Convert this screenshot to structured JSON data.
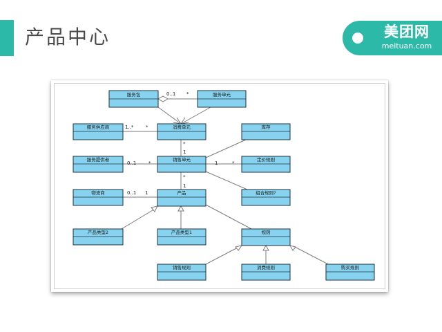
{
  "slide": {
    "title": "产品中心"
  },
  "logo": {
    "text": "美团网",
    "sub": "meituan.com",
    "color": "#2db9a8"
  },
  "diagram": {
    "classes": {
      "service_package": "服务包",
      "service_unit": "服务单元",
      "service_supplier": "服务供应商",
      "consumption_unit": "消费单元",
      "inventory": "库存",
      "service_provider": "服务提供者",
      "sales_unit": "销售单元",
      "pricing_rule": "定价规则",
      "logistics": "物流商",
      "product": "产品",
      "combination_rule": "组合规则?",
      "product_type_2": "产品类型2",
      "product_type_1": "产品类型1",
      "rule": "规则",
      "sales_rule": "销售规则",
      "consumption_rule": "消费规则",
      "purchase_limit_rule": "购买规则"
    },
    "multiplicities": {
      "pkg_unit_left": "0..1",
      "pkg_unit_right": "*",
      "supplier_left": "1..*",
      "supplier_right": "*",
      "consume_sales_top": "*",
      "consume_sales_bottom": "1",
      "provider_left": "0..1",
      "provider_right": "*",
      "pricing_left": "1",
      "pricing_right": "*",
      "sales_product_top": "*",
      "sales_product_bottom": "1",
      "logistics_left": "0..1",
      "logistics_right": "1"
    },
    "colors": {
      "class_fill": "#87d3ef",
      "class_border": "#1f2f3f",
      "line": "#7a7a7a"
    }
  }
}
